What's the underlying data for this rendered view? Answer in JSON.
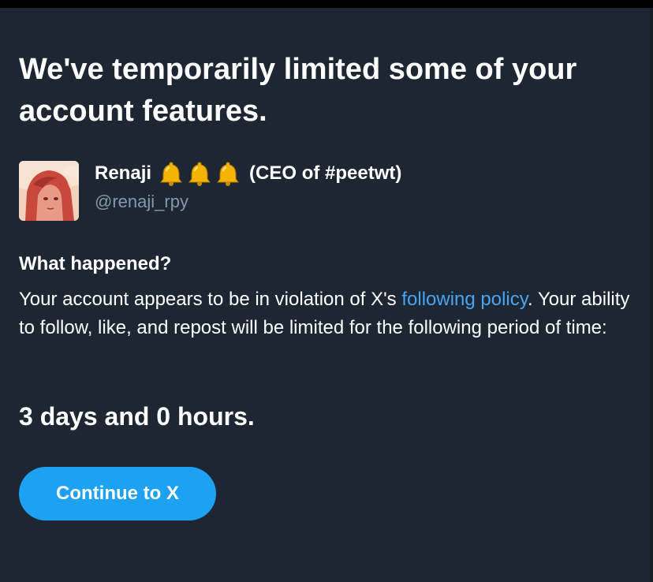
{
  "colors": {
    "background": "#1c2733",
    "text": "#ffffff",
    "secondary_text": "#8899a6",
    "link": "#4aa3f0",
    "button": "#1da1f2"
  },
  "dialog": {
    "title": "We've temporarily limited some of your account features.",
    "user": {
      "avatar_icon": "anime-avatar-image",
      "display_name": "Renaji",
      "name_emoji": [
        "bell-icon",
        "bell-icon",
        "bell-icon"
      ],
      "name_suffix": "(CEO of #peetwt)",
      "handle": "@renaji_rpy"
    },
    "section_heading": "What happened?",
    "message": {
      "before_link": "Your account appears to be in violation of X's ",
      "link_text": "following policy",
      "after_link": ". Your ability to follow, like, and repost will be limited for the following period of time:"
    },
    "duration": "3 days and 0 hours.",
    "continue_label": "Continue to X"
  }
}
